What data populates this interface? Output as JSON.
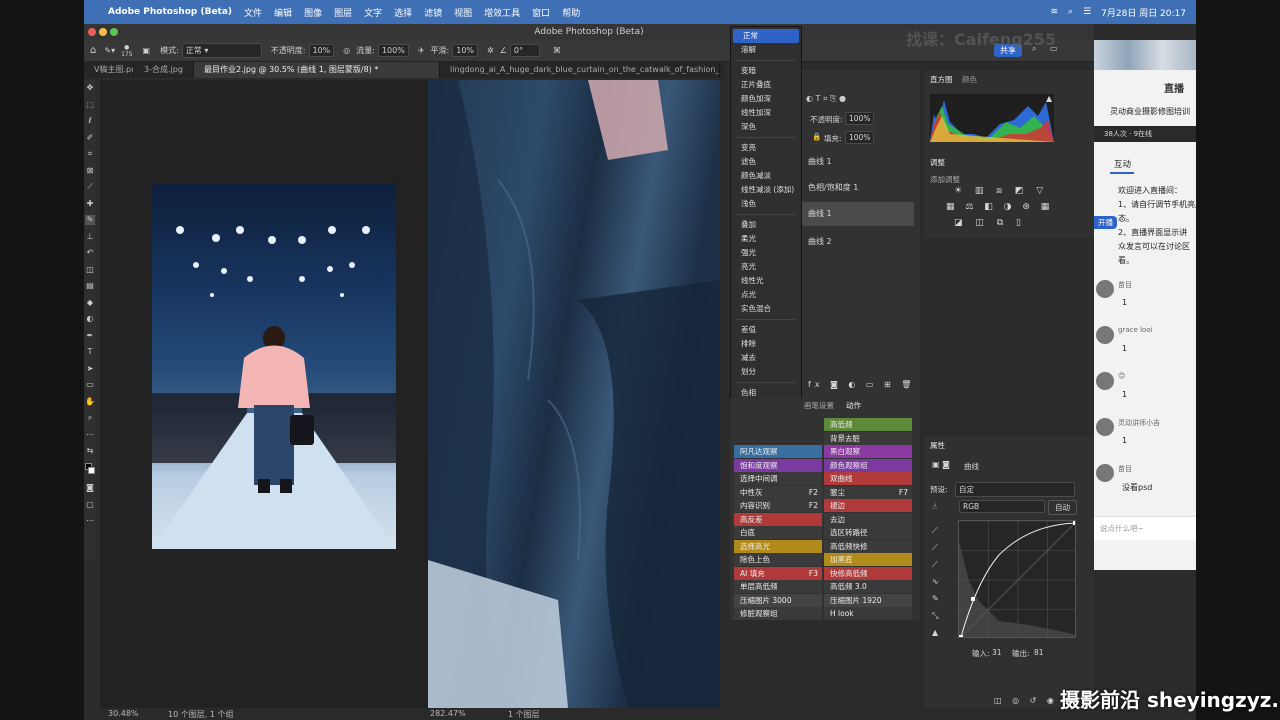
{
  "menubar": {
    "apple": "",
    "app": "Adobe Photoshop (Beta)",
    "items": [
      "文件",
      "编辑",
      "图像",
      "图层",
      "文字",
      "选择",
      "滤镜",
      "视图",
      "增效工具",
      "窗口",
      "帮助"
    ],
    "clock": "7月28日 周日  20:17"
  },
  "window_title": "Adobe Photoshop (Beta)",
  "options": {
    "mode_label": "模式:",
    "mode_value": "正常",
    "opacity_label": "不透明度:",
    "opacity_value": "10%",
    "flow_label": "流量:",
    "flow_value": "100%",
    "smooth_label": "平滑:",
    "smooth_value": "10%",
    "angle_value": "0°",
    "brush_size": "175",
    "share_label": "共享"
  },
  "tabs": [
    "V稿主图.png",
    "3-合成.jpg",
    "最目作业2.jpg @ 30.5% (曲线 1, 图层蒙版/8) *",
    "lingdong_ai_A_huge_dark_blue_curtain_on_the_catwalk_of_fashion__a"
  ],
  "status_left": {
    "zoom": "30.48%",
    "info": "10 个图层, 1 个组"
  },
  "status_right": {
    "zoom": "282.47%",
    "info": "1 个图层"
  },
  "blend_dropdown": {
    "groups": [
      [
        "正常",
        "溶解"
      ],
      [
        "变暗",
        "正片叠底",
        "颜色加深",
        "线性加深",
        "深色"
      ],
      [
        "变亮",
        "滤色",
        "颜色减淡",
        "线性减淡 (添加)",
        "浅色"
      ],
      [
        "叠加",
        "柔光",
        "强光",
        "亮光",
        "线性光",
        "点光",
        "实色混合"
      ],
      [
        "差值",
        "排除",
        "减去",
        "划分"
      ],
      [
        "色相",
        "饱和度",
        "颜色"
      ]
    ]
  },
  "layers_panel": {
    "opacity_label": "不透明度:",
    "opacity_value": "100%",
    "fill_label": "填充:",
    "fill_value": "100%",
    "layers": [
      "曲线 1",
      "色相/饱和度 1",
      "曲线 1",
      "曲线 2"
    ]
  },
  "actions_panel": {
    "tabs": [
      "画笔设置",
      "动作"
    ],
    "buttons": [
      {
        "label": "高低频",
        "key": "",
        "color": "#5d8a3a",
        "col": 1,
        "row": 0
      },
      {
        "label": "背景去脏",
        "key": "",
        "color": "#3a3a3a",
        "col": 1,
        "row": 1
      },
      {
        "label": "阿凡达观察",
        "key": "",
        "color": "#3a6ea0",
        "col": 0,
        "row": 2
      },
      {
        "label": "黑白观察",
        "key": "",
        "color": "#8a3aa0",
        "col": 1,
        "row": 2
      },
      {
        "label": "饱和度观察",
        "key": "",
        "color": "#7a3aa0",
        "col": 0,
        "row": 3
      },
      {
        "label": "颜色观察组",
        "key": "",
        "color": "#7a3aa0",
        "col": 1,
        "row": 3
      },
      {
        "label": "选择中间调",
        "key": "",
        "color": "#3a3a3a",
        "col": 0,
        "row": 4
      },
      {
        "label": "双曲线",
        "key": "",
        "color": "#b03a3a",
        "col": 1,
        "row": 4
      },
      {
        "label": "中性灰",
        "key": "F2",
        "color": "#3a3a3a",
        "col": 0,
        "row": 5
      },
      {
        "label": "塞尘",
        "key": "F7",
        "color": "#3a3a3a",
        "col": 1,
        "row": 5
      },
      {
        "label": "内容识别",
        "key": "F2",
        "color": "#3a3a3a",
        "col": 0,
        "row": 6
      },
      {
        "label": "褪边",
        "key": "",
        "color": "#b03a3a",
        "col": 1,
        "row": 6
      },
      {
        "label": "高反差",
        "key": "",
        "color": "#b03a3a",
        "col": 0,
        "row": 7
      },
      {
        "label": "去边",
        "key": "",
        "color": "#3a3a3a",
        "col": 1,
        "row": 7
      },
      {
        "label": "白底",
        "key": "",
        "color": "#3a3a3a",
        "col": 0,
        "row": 8
      },
      {
        "label": "选区转路径",
        "key": "",
        "color": "#3a3a3a",
        "col": 1,
        "row": 8
      },
      {
        "label": "选择高光",
        "key": "",
        "color": "#b08a1a",
        "col": 0,
        "row": 9
      },
      {
        "label": "高低频快修",
        "key": "",
        "color": "#3a3a3a",
        "col": 1,
        "row": 9
      },
      {
        "label": "除色上色",
        "key": "",
        "color": "#3a3a3a",
        "col": 0,
        "row": 10
      },
      {
        "label": "加黑底",
        "key": "",
        "color": "#b08a1a",
        "col": 1,
        "row": 10
      },
      {
        "label": "AI 填充",
        "key": "F3",
        "color": "#b03a3a",
        "col": 0,
        "row": 11
      },
      {
        "label": "快修高低频",
        "key": "",
        "color": "#b03a3a",
        "col": 1,
        "row": 11
      },
      {
        "label": "单层高低频",
        "key": "",
        "color": "#3a3a3a",
        "col": 0,
        "row": 12
      },
      {
        "label": "高低频 3.0",
        "key": "",
        "color": "#3a3a3a",
        "col": 1,
        "row": 12
      },
      {
        "label": "压缩图片 3000",
        "key": "",
        "color": "#444",
        "col": 0,
        "row": 13
      },
      {
        "label": "压缩图片 1920",
        "key": "",
        "color": "#444",
        "col": 1,
        "row": 13
      },
      {
        "label": "修脏观察组",
        "key": "",
        "color": "#3a3a3a",
        "col": 0,
        "row": 14
      },
      {
        "label": "H look",
        "key": "",
        "color": "#3a3a3a",
        "col": 1,
        "row": 14
      }
    ]
  },
  "histogram": {
    "tabs": [
      "直方图",
      "颜色"
    ]
  },
  "adjustments": {
    "title": "调整",
    "subtitle": "添加调整"
  },
  "properties": {
    "title": "属性",
    "layer": "曲线",
    "preset_label": "预设:",
    "preset_value": "自定",
    "channel": "RGB",
    "auto": "自动",
    "input_label": "输入:",
    "input_value": "31",
    "output_label": "输出:",
    "output_value": "81"
  },
  "live_app": {
    "title": "直播",
    "course": "灵动商业摄影修图培训",
    "viewers": "38人次 · 9在线",
    "tab": "互动",
    "welcome": "欢迎进入直播间：",
    "line1": "1、请自行调节手机亮度",
    "line2": "态。",
    "line3": "2、直播界面显示讲",
    "line4": "众发言可以在讨论区",
    "line5": "看。",
    "open_btn": "开播",
    "messages": [
      {
        "user": "苗目",
        "text": "1"
      },
      {
        "user": "grace looi",
        "text": "1"
      },
      {
        "user": "😊",
        "text": "1"
      },
      {
        "user": "灵动讲师小吉",
        "text": "1"
      },
      {
        "user": "苗目",
        "text": "没看psd"
      }
    ],
    "input_placeholder": "说点什么吧~"
  },
  "watermark_top": "找课：Caifeng255",
  "watermark_bottom": "摄影前沿 sheyingzyz.com"
}
